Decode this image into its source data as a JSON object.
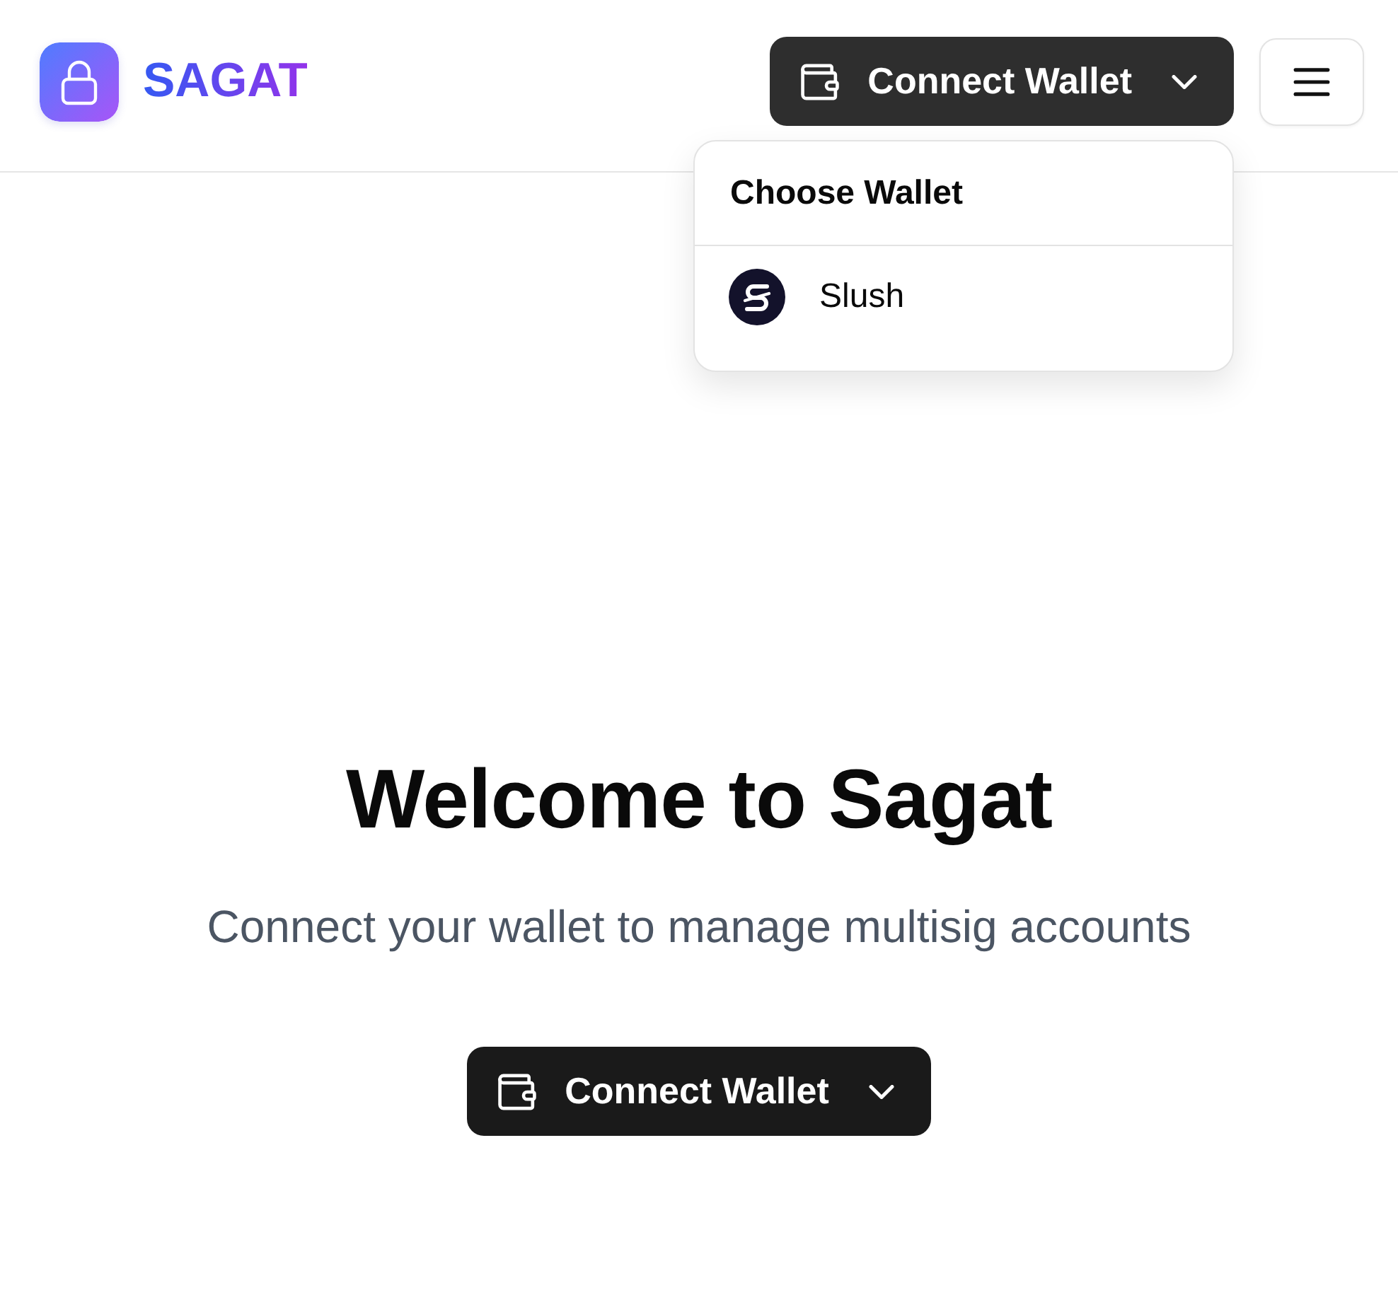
{
  "header": {
    "logo": {
      "text": "SAGAT"
    },
    "connect_button": {
      "label": "Connect Wallet",
      "expanded": true
    },
    "wallet_menu": {
      "title": "Choose Wallet",
      "items": [
        {
          "label": "Slush"
        }
      ]
    }
  },
  "main": {
    "title": "Welcome to Sagat",
    "subtitle": "Connect your wallet to manage multisig accounts",
    "connect_button": {
      "label": "Connect Wallet",
      "expanded": false
    }
  }
}
